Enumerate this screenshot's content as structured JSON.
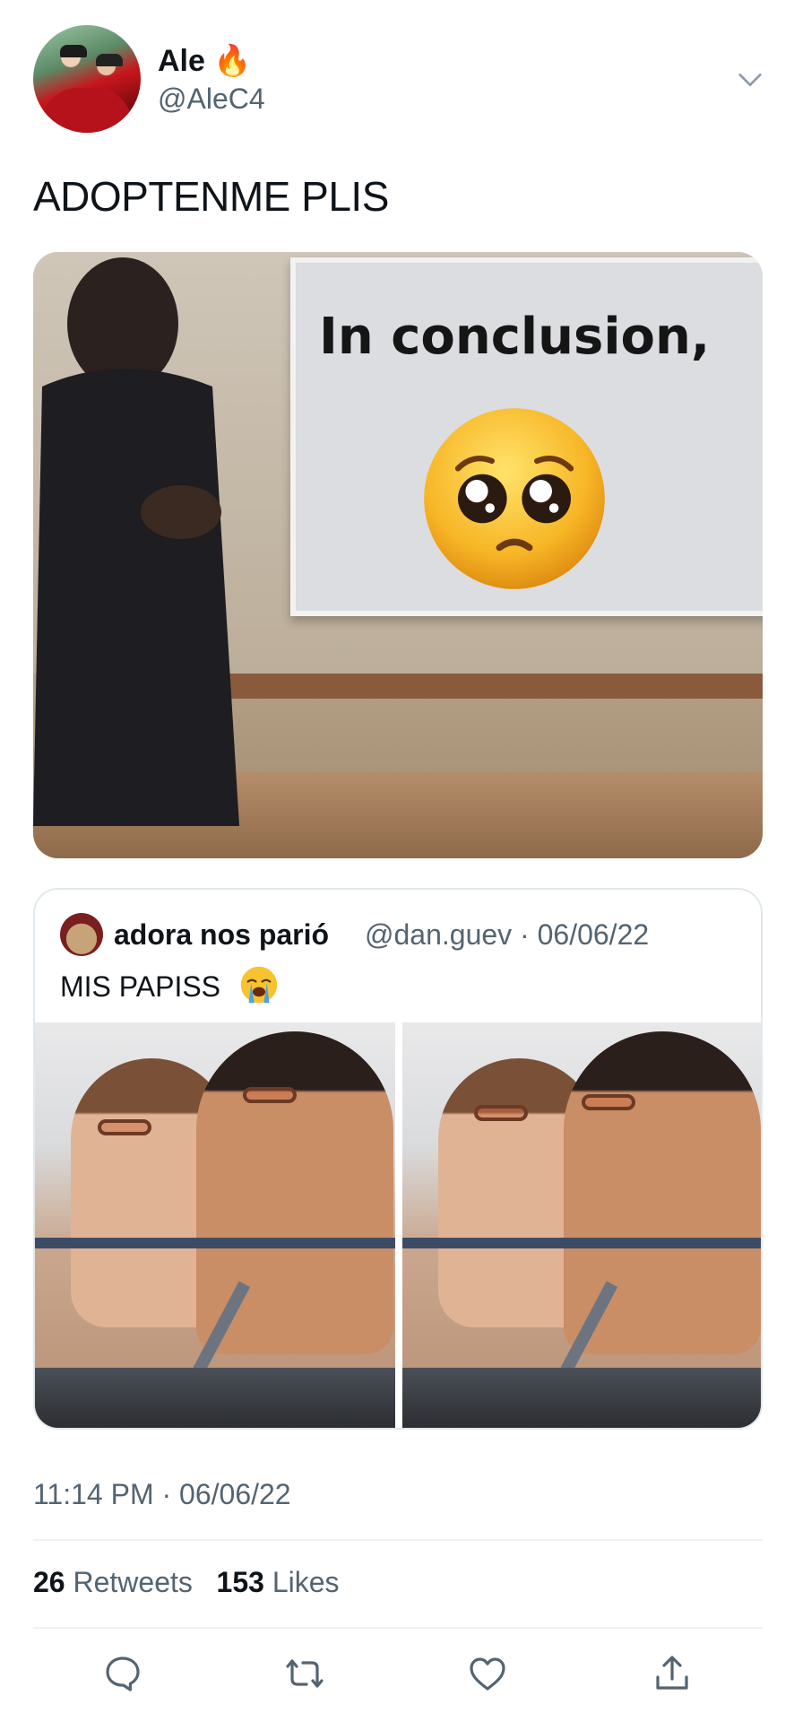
{
  "author": {
    "display_name": "Ale",
    "name_emoji": "🔥",
    "handle": "@AleC4"
  },
  "tweet": {
    "text": "ADOPTENME PLIS",
    "meme_board_text": "In conclusion,",
    "meme_emoji": "pleading-face"
  },
  "quote": {
    "author_name": "adora nos parió",
    "meta": "@dan.guev · 06/06/22",
    "text": "MIS PAPISS",
    "text_emoji": "😭"
  },
  "footer": {
    "timestamp": "11:14 PM · 06/06/22",
    "retweets_count": "26",
    "retweets_label": "Retweets",
    "likes_count": "153",
    "likes_label": "Likes"
  },
  "actions": [
    "reply-icon",
    "retweet-icon",
    "like-icon",
    "share-icon"
  ],
  "colors": {
    "primary_text": "#0f1419",
    "secondary_text": "#536471",
    "divider": "#eff3f4",
    "border": "#e1e8ed"
  }
}
